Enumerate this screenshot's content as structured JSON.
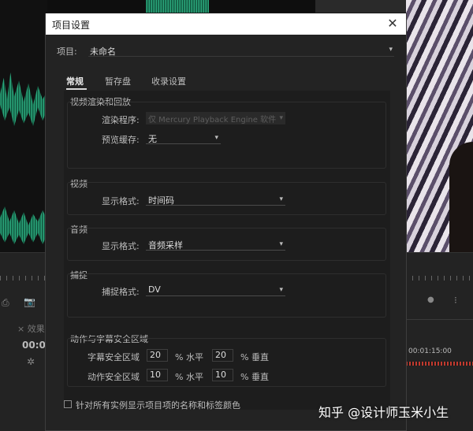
{
  "background": {
    "left_tab": "× 效果",
    "left_timecode": "00:0",
    "right_timecode": "00:01:15:00"
  },
  "dialog": {
    "title": "项目设置",
    "close_icon": "close-icon",
    "project_label": "项目:",
    "project_name": "未命名",
    "tabs": [
      {
        "label": "常规",
        "active": true
      },
      {
        "label": "暂存盘",
        "active": false
      },
      {
        "label": "收录设置",
        "active": false
      }
    ],
    "video_render": {
      "title": "视频渲染和回放",
      "renderer_label": "渲染程序:",
      "renderer_value": "仅 Mercury Playback Engine 软件",
      "renderer_disabled": true,
      "preview_cache_label": "预览缓存:",
      "preview_cache_value": "无"
    },
    "video": {
      "title": "视频",
      "display_format_label": "显示格式:",
      "display_format_value": "时间码"
    },
    "audio": {
      "title": "音频",
      "display_format_label": "显示格式:",
      "display_format_value": "音频采样"
    },
    "capture": {
      "title": "捕捉",
      "capture_format_label": "捕捉格式:",
      "capture_format_value": "DV"
    },
    "safe_areas": {
      "title": "动作与字幕安全区域",
      "title_safe_label": "字幕安全区域",
      "title_safe_h": "20",
      "title_safe_v": "20",
      "action_safe_label": "动作安全区域",
      "action_safe_h": "10",
      "action_safe_v": "10",
      "horizontal_unit": "% 水平",
      "vertical_unit": "% 垂直"
    },
    "show_names_checkbox": {
      "label": "针对所有实例显示项目项的名称和标签颜色",
      "checked": false
    }
  },
  "watermark": "知乎 @设计师玉米小生"
}
